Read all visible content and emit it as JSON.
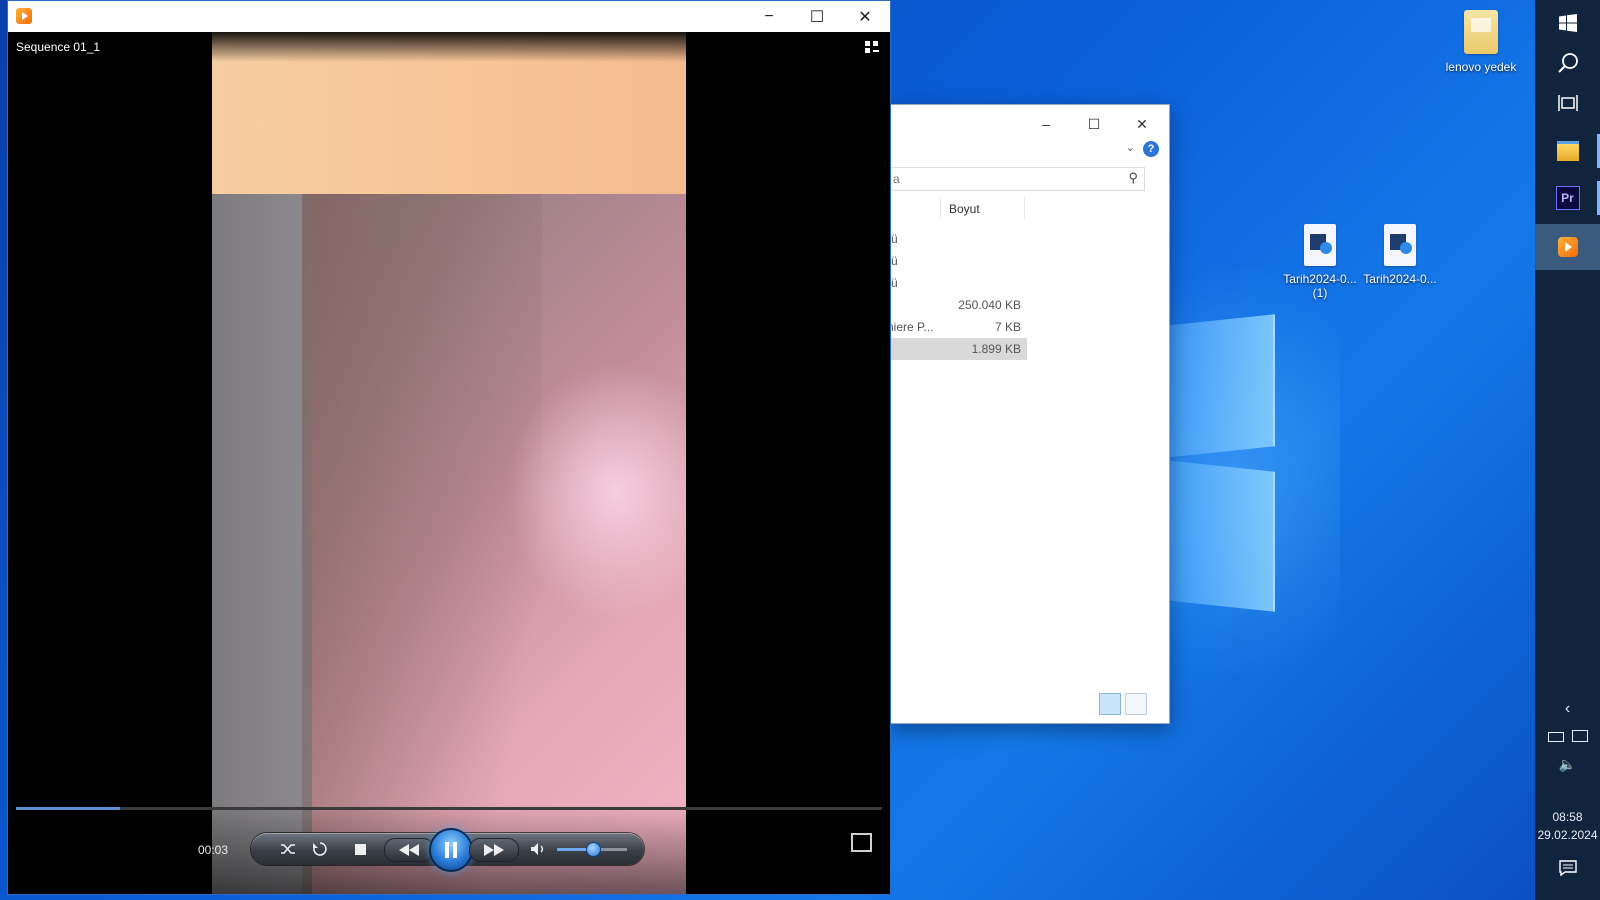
{
  "desktop": {
    "icons": [
      {
        "label": "lenovo yedek",
        "type": "folder"
      },
      {
        "label": "Tarih2024-0...\n(1)",
        "type": "media"
      },
      {
        "label": "Tarih2024-0...",
        "type": "media"
      }
    ]
  },
  "player": {
    "title": "",
    "media_title": "Sequence 01_1",
    "time": "00:03",
    "progress": 0.12,
    "volume": 0.5,
    "controls": [
      "shuffle",
      "repeat",
      "stop",
      "previous",
      "pause",
      "next",
      "mute",
      "volume"
    ],
    "window_controls": {
      "minimize": "−",
      "maximize": "☐",
      "close": "✕"
    }
  },
  "explorer": {
    "column_header": "Boyut",
    "search_fragment": "a",
    "rows": [
      {
        "name": "rü",
        "size": ""
      },
      {
        "name": "rü",
        "size": ""
      },
      {
        "name": "rü",
        "size": ""
      },
      {
        "name": "",
        "size": "250.040 KB"
      },
      {
        "name": "niere P...",
        "size": "7 KB"
      },
      {
        "name": "",
        "size": "1.899 KB",
        "selected": true
      }
    ],
    "help": "?"
  },
  "taskbar": {
    "clock_time": "08:58",
    "clock_date": "29.02.2024",
    "apps": [
      "windows-start",
      "search",
      "task-view",
      "file-explorer",
      "premiere-pro",
      "media-player"
    ],
    "premiere_label": "Pr"
  }
}
